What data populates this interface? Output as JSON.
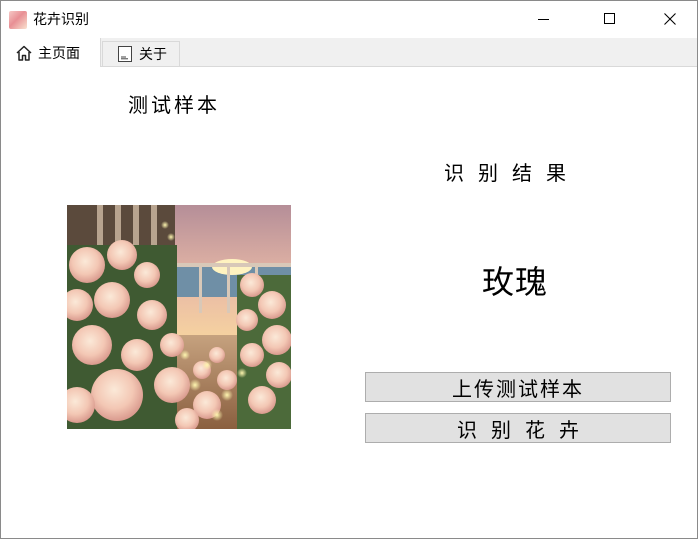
{
  "window": {
    "title": "花卉识别",
    "controls": [
      "minimize-icon",
      "maximize-icon",
      "close-icon"
    ]
  },
  "tabs": [
    {
      "label": "主页面",
      "icon": "home-icon",
      "selected": true
    },
    {
      "label": "关于",
      "icon": "document-icon",
      "selected": false
    }
  ],
  "main": {
    "sample_label": "测试样本",
    "result_label": "识别结果",
    "result_value": "玫瑰",
    "upload_button": "上传测试样本",
    "identify_button": "识别花卉"
  },
  "colors": {
    "button_bg": "#e1e1e1",
    "button_border": "#adadad",
    "tab_bar_bg": "#f0f0f0"
  }
}
